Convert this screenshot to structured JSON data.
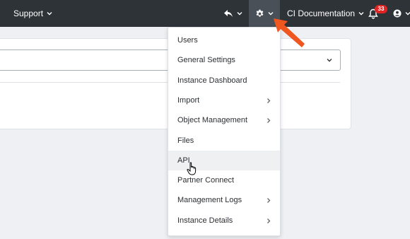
{
  "topbar": {
    "support_label": "Support",
    "ci_documentation_label": "CI Documentation",
    "notification_count": "33"
  },
  "menu": {
    "items": [
      {
        "label": "Users"
      },
      {
        "label": "General Settings"
      },
      {
        "label": "Instance Dashboard"
      },
      {
        "label": "Import",
        "submenu": true
      },
      {
        "label": "Object Management",
        "submenu": true
      },
      {
        "label": "Files"
      },
      {
        "label": "API",
        "hovered": true
      },
      {
        "label": "Partner Connect"
      },
      {
        "label": "Management Logs",
        "submenu": true
      },
      {
        "label": "Instance Details",
        "submenu": true
      }
    ]
  },
  "icons": {
    "reply": "reply-icon",
    "gear": "gear-icon",
    "bell": "bell-icon",
    "user": "user-circle-icon",
    "chevron": "chevron-down-icon",
    "submenu_chevron": "chevron-right-icon",
    "annotation_arrow": "arrow-annotation",
    "cursor": "hand-pointer-cursor"
  },
  "colors": {
    "topbar": "#2e3338",
    "annotation_arrow": "#f0561f",
    "badge": "#e02424"
  }
}
